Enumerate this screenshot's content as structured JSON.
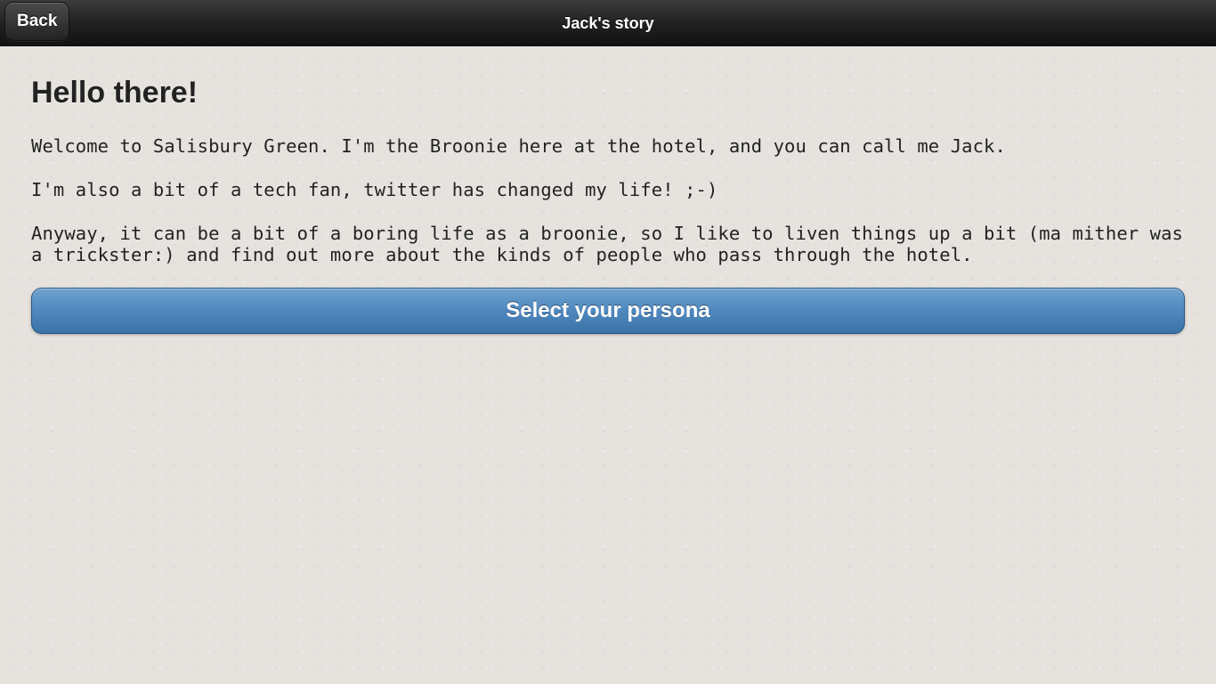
{
  "header": {
    "back_label": "Back",
    "title": "Jack's story"
  },
  "main": {
    "heading": "Hello there!",
    "paragraphs": [
      "Welcome to Salisbury Green. I'm the Broonie here at the hotel, and you can call me Jack.",
      "I'm also a bit of a tech fan, twitter has changed my life! ;-)",
      "Anyway, it can be a bit of a boring life as a broonie, so I like to liven things up a bit (ma mither was a trickster:) and find out more about the kinds of people who pass through the hotel."
    ],
    "action_label": "Select your persona"
  },
  "colors": {
    "header_bg": "#1c1c1c",
    "page_bg": "#e6e3df",
    "button_accent": "#4f88be"
  }
}
